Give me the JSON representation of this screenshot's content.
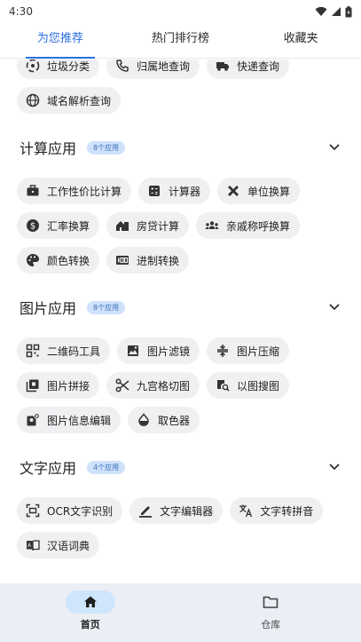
{
  "status_bar": {
    "time": "4:30"
  },
  "tabs": [
    {
      "label": "为您推荐",
      "active": true
    },
    {
      "label": "热门排行榜",
      "active": false
    },
    {
      "label": "收藏夹",
      "active": false
    }
  ],
  "top_chips": [
    {
      "label": "垃圾分类",
      "icon": "recycle-icon"
    },
    {
      "label": "归属地查询",
      "icon": "phone-icon"
    },
    {
      "label": "快递查询",
      "icon": "truck-icon"
    },
    {
      "label": "域名解析查询",
      "icon": "globe-icon"
    }
  ],
  "sections": [
    {
      "title": "计算应用",
      "badge": "8个应用",
      "chips": [
        {
          "label": "工作性价比计算",
          "icon": "briefcase-icon"
        },
        {
          "label": "计算器",
          "icon": "calculator-icon"
        },
        {
          "label": "单位换算",
          "icon": "tools-icon"
        },
        {
          "label": "汇率换算",
          "icon": "dollar-icon"
        },
        {
          "label": "房贷计算",
          "icon": "house-icon"
        },
        {
          "label": "亲戚称呼换算",
          "icon": "people-icon"
        },
        {
          "label": "颜色转换",
          "icon": "palette-icon"
        },
        {
          "label": "进制转换",
          "icon": "number-100-icon"
        }
      ]
    },
    {
      "title": "图片应用",
      "badge": "8个应用",
      "chips": [
        {
          "label": "二维码工具",
          "icon": "qrcode-icon"
        },
        {
          "label": "图片滤镜",
          "icon": "filter-icon"
        },
        {
          "label": "图片压缩",
          "icon": "compress-icon"
        },
        {
          "label": "图片拼接",
          "icon": "collage-icon"
        },
        {
          "label": "九宫格切图",
          "icon": "scissors-icon"
        },
        {
          "label": "以图搜图",
          "icon": "image-search-icon"
        },
        {
          "label": "图片信息编辑",
          "icon": "image-edit-icon"
        },
        {
          "label": "取色器",
          "icon": "drop-icon"
        }
      ]
    },
    {
      "title": "文字应用",
      "badge": "4个应用",
      "chips": [
        {
          "label": "OCR文字识别",
          "icon": "scan-text-icon"
        },
        {
          "label": "文字编辑器",
          "icon": "pen-icon"
        },
        {
          "label": "文字转拼音",
          "icon": "translate-icon"
        },
        {
          "label": "汉语词典",
          "icon": "dictionary-icon"
        }
      ]
    }
  ],
  "bottom_nav": [
    {
      "label": "首页",
      "icon": "home-icon",
      "active": true
    },
    {
      "label": "仓库",
      "icon": "folder-icon",
      "active": false
    }
  ],
  "colors": {
    "accent": "#2f6fe0",
    "chip_bg": "#f0f0f3",
    "badge_bg": "#cfe2fb",
    "nav_bg": "#eceef5"
  }
}
